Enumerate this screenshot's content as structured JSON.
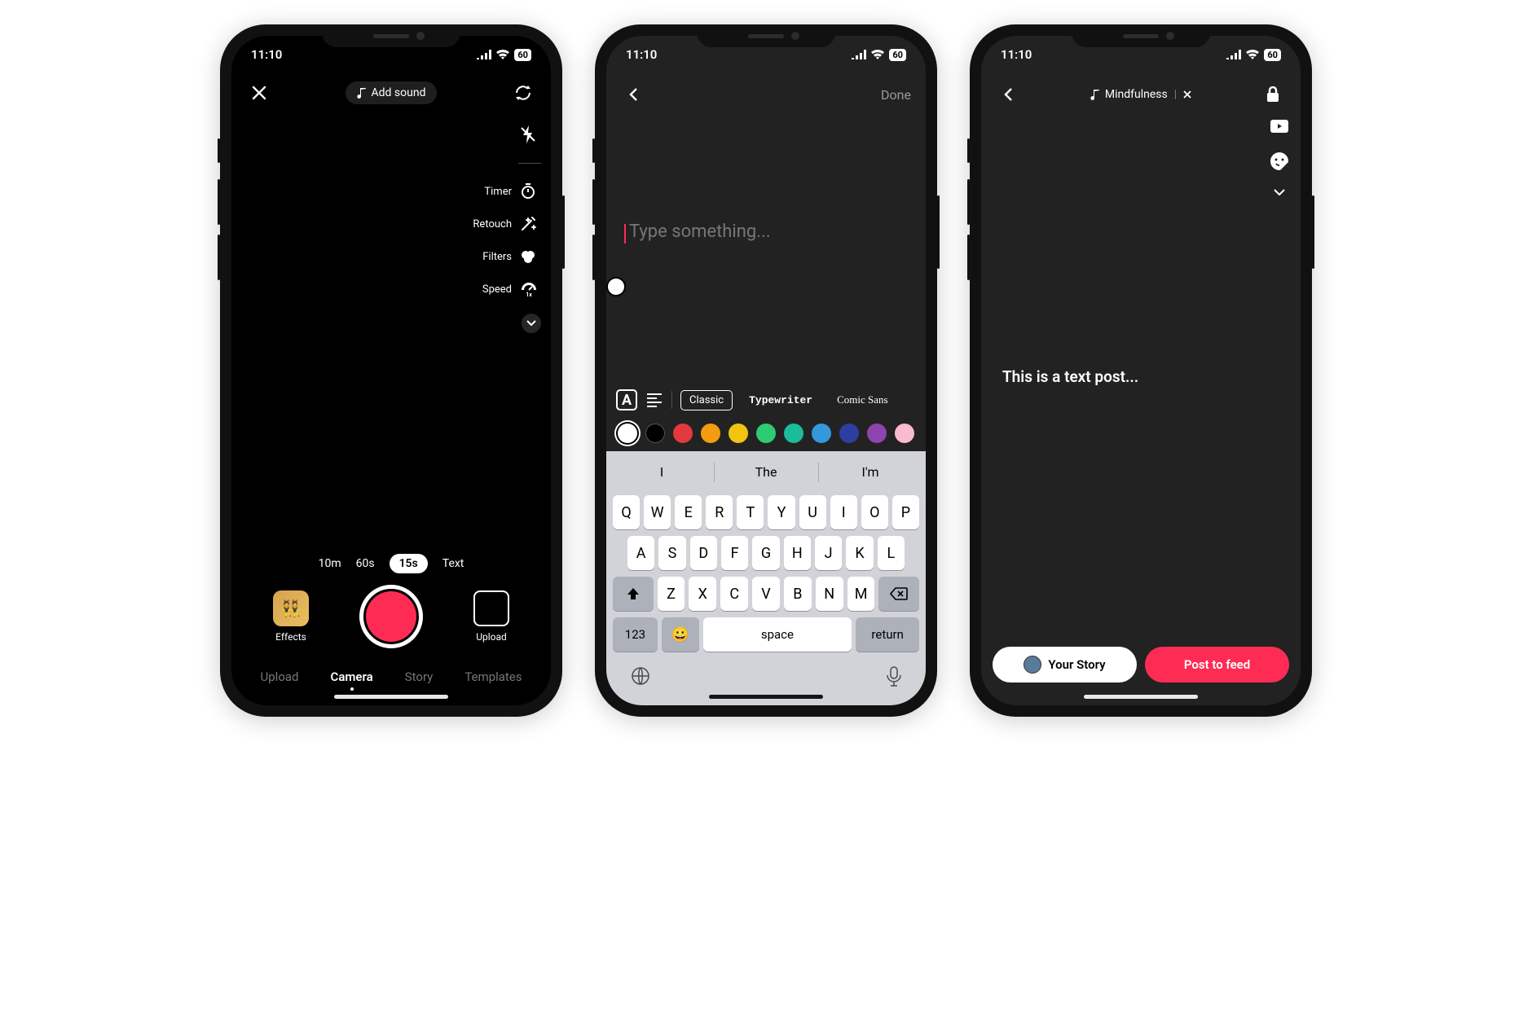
{
  "status": {
    "time": "11:10",
    "battery": "60"
  },
  "screen1": {
    "add_sound": "Add sound",
    "tools": {
      "timer": "Timer",
      "retouch": "Retouch",
      "filters": "Filters",
      "speed": "Speed"
    },
    "durations": [
      "10m",
      "60s",
      "15s",
      "Text"
    ],
    "duration_selected": "15s",
    "effects_label": "Effects",
    "upload_label": "Upload",
    "tabs": [
      "Upload",
      "Camera",
      "Story",
      "Templates"
    ],
    "tab_selected": "Camera"
  },
  "screen2": {
    "done": "Done",
    "placeholder": "Type something...",
    "fonts": [
      "Classic",
      "Typewriter",
      "Comic Sans"
    ],
    "font_selected": "Classic",
    "colors": [
      "#ffffff",
      "#000000",
      "#e4393c",
      "#f39c12",
      "#f1c40f",
      "#2ecc71",
      "#1abc9c",
      "#3498db",
      "#2c3e9f",
      "#8e44ad",
      "#f8bbd0"
    ],
    "color_selected": "#ffffff",
    "suggestions": [
      "I",
      "The",
      "I'm"
    ],
    "keys_r1": [
      "Q",
      "W",
      "E",
      "R",
      "T",
      "Y",
      "U",
      "I",
      "O",
      "P"
    ],
    "keys_r2": [
      "A",
      "S",
      "D",
      "F",
      "G",
      "H",
      "J",
      "K",
      "L"
    ],
    "keys_r3": [
      "Z",
      "X",
      "C",
      "V",
      "B",
      "N",
      "M"
    ],
    "key_123": "123",
    "key_space": "space",
    "key_return": "return"
  },
  "screen3": {
    "sound_name": "Mindfulness",
    "text_content": "This is a text post...",
    "your_story": "Your Story",
    "post": "Post to feed"
  }
}
